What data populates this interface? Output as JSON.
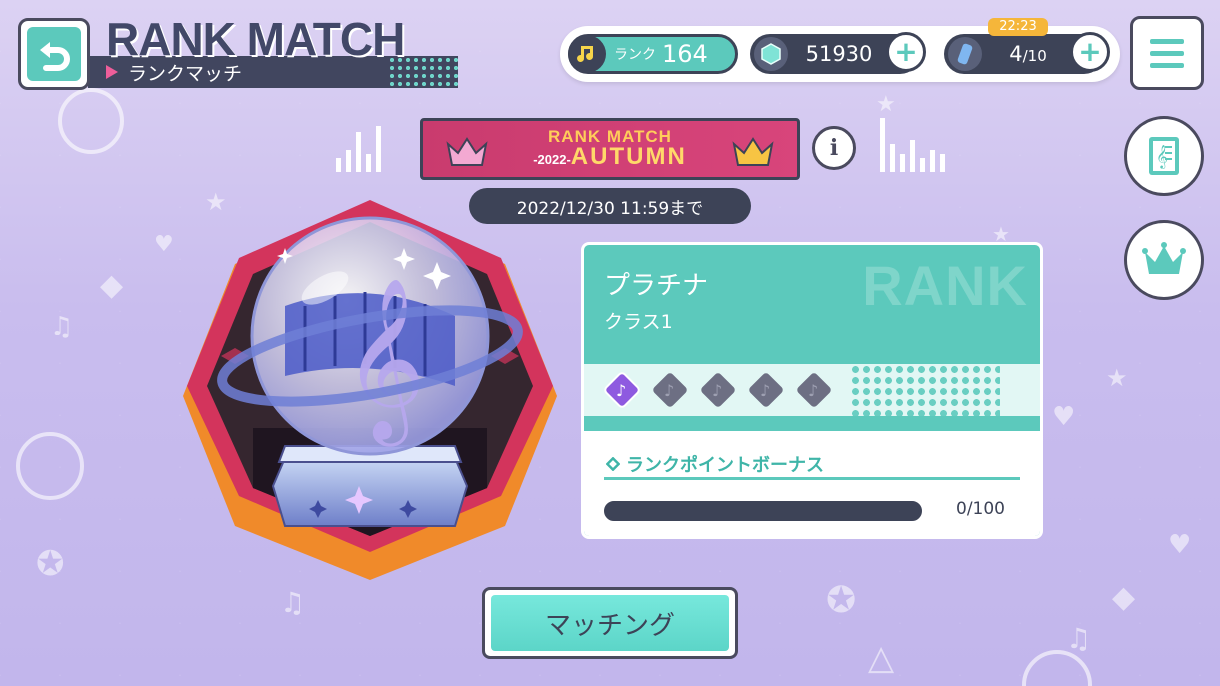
{
  "header": {
    "title": "RANK MATCH",
    "subtitle": "ランクマッチ",
    "back_icon": "back-arrow-icon",
    "menu_icon": "hamburger-menu-icon"
  },
  "status": {
    "rank_label": "ランク",
    "rank_value": "164",
    "gems": "51930",
    "stamina_timer": "22:23",
    "stamina_current": "4",
    "stamina_max": "/10"
  },
  "season": {
    "banner_line1": "RANK MATCH",
    "banner_year": "-2022-",
    "banner_line2": "AUTUMN",
    "deadline": "2022/12/30 11:59まで"
  },
  "rank_card": {
    "rank_name": "プラチナ",
    "rank_class": "クラス1",
    "watermark": "RANK",
    "steps_total": 5,
    "steps_filled": 1,
    "bonus_title": "ランクポイントボーナス",
    "bonus_value": "0/100",
    "bonus_progress": 0
  },
  "buttons": {
    "matching": "マッチング"
  },
  "colors": {
    "accent": "#5cc9bc",
    "dark": "#3d4357",
    "banner": "#c93b6e",
    "step_active": "#8e5ae0",
    "step_inactive": "#6d6f83"
  }
}
